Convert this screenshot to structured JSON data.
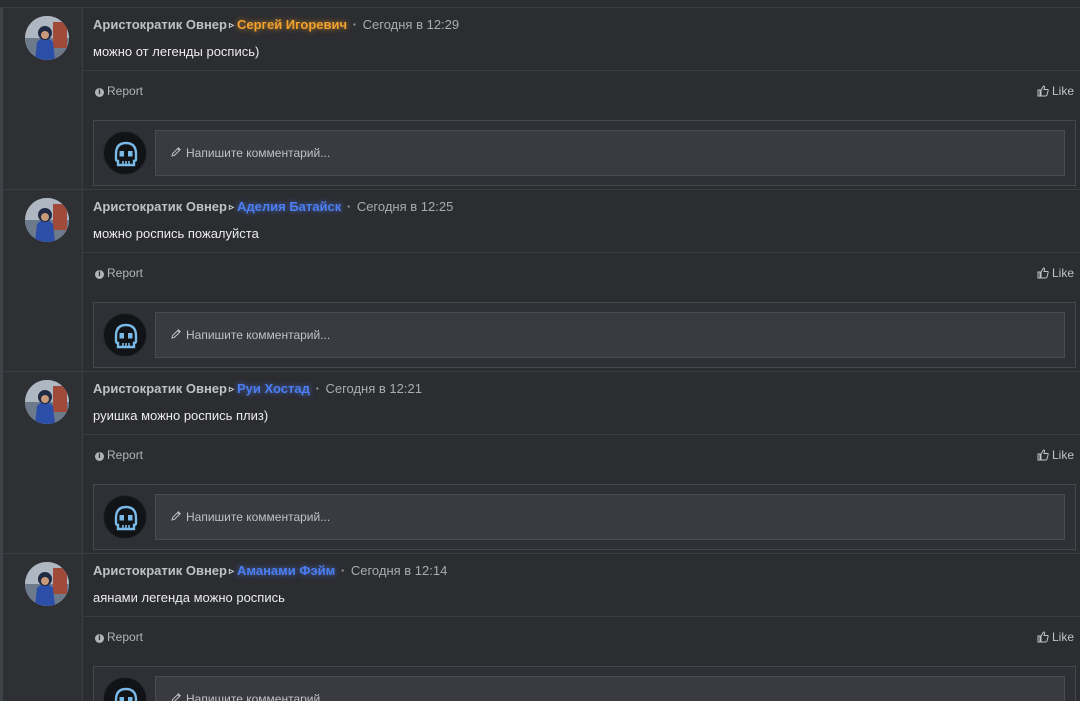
{
  "colors": {
    "background": "#2c2d31",
    "mention_gold": "#f2a12c",
    "mention_blue": "#4c7ef2"
  },
  "posts": [
    {
      "author": "Аристократик Овнер",
      "target": "Сергей Игоревич",
      "target_style": "gold",
      "time": "Сегодня в 12:29",
      "message": "можно от легенды роспись)",
      "report_label": "Report",
      "like_label": "Like",
      "comment_placeholder": "Напишите комментарий..."
    },
    {
      "author": "Аристократик Овнер",
      "target": "Аделия Батайск",
      "target_style": "blue",
      "time": "Сегодня в 12:25",
      "message": "можно роспись пожалуйста",
      "report_label": "Report",
      "like_label": "Like",
      "comment_placeholder": "Напишите комментарий..."
    },
    {
      "author": "Аристократик Овнер",
      "target": "Руи Хостад",
      "target_style": "blue",
      "time": "Сегодня в 12:21",
      "message": "руишка можно роспись плиз)",
      "report_label": "Report",
      "like_label": "Like",
      "comment_placeholder": "Напишите комментарий..."
    },
    {
      "author": "Аристократик Овнер",
      "target": "Аманами Фэйм",
      "target_style": "blue",
      "time": "Сегодня в 12:14",
      "message": "аянами легенда можно роспись",
      "report_label": "Report",
      "like_label": "Like",
      "comment_placeholder": "Напишите комментарий..."
    }
  ],
  "separators": {
    "arrow": "▹",
    "dot": "·"
  },
  "icons": {
    "arrow": "caret-right-icon",
    "report": "info-circle-icon",
    "like": "thumbs-up-icon",
    "pencil": "pencil-icon",
    "commenter_avatar": "skull-avatar-icon"
  }
}
